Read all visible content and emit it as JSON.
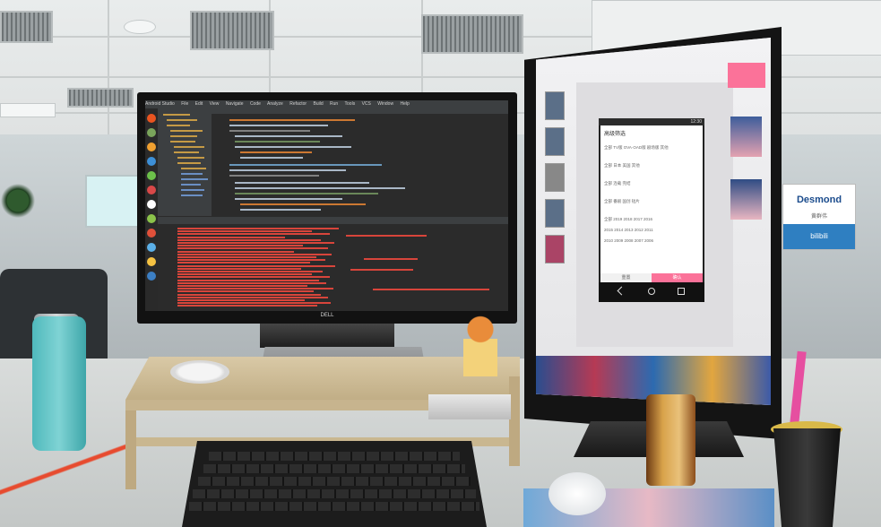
{
  "scene": {
    "description_tags": [
      "office-desk",
      "dual-monitor"
    ],
    "left_monitor": {
      "brand": "DELL",
      "menu": [
        "Android Studio",
        "File",
        "Edit",
        "View",
        "Navigate",
        "Code",
        "Analyze",
        "Refactor",
        "Build",
        "Run",
        "Tools",
        "VCS",
        "Window",
        "Help"
      ]
    },
    "right_monitor": {
      "phone": {
        "status_time": "12:30",
        "title": "高级筛选",
        "filter_rows": [
          "全部  TV版  OVA·OAD版  剧场版  其他",
          "全部  日本  美国  其他",
          "全部  连载  完结",
          "全部  番剧  国创  短片",
          "全部  2019 2018 2017 2016",
          "2015 2014 2013 2012 2011",
          "2010 2009 2008 2007 2006"
        ],
        "reset_label": "重置",
        "confirm_label": "确认"
      }
    },
    "name_card": {
      "name": "Desmond",
      "sub": "黄群伟",
      "brand": "bilibili"
    }
  },
  "colors": {
    "accent_pink": "#fb7299",
    "log_red": "#d8453b",
    "ide_dark": "#2b2b2b"
  }
}
